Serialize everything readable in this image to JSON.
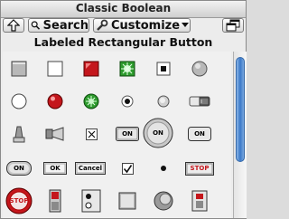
{
  "window": {
    "title": "Classic Boolean"
  },
  "toolbar": {
    "search_label": "Search",
    "customize_label": "Customize"
  },
  "palette": {
    "header": "Labeled Rectangular Button",
    "labels": {
      "on": "ON",
      "ok": "OK",
      "cancel": "Cancel",
      "stop": "STOP"
    }
  },
  "colors": {
    "led_red": "#c4161c",
    "led_green": "#2e9b2e",
    "scroll_thumb": "#3a78c8"
  }
}
